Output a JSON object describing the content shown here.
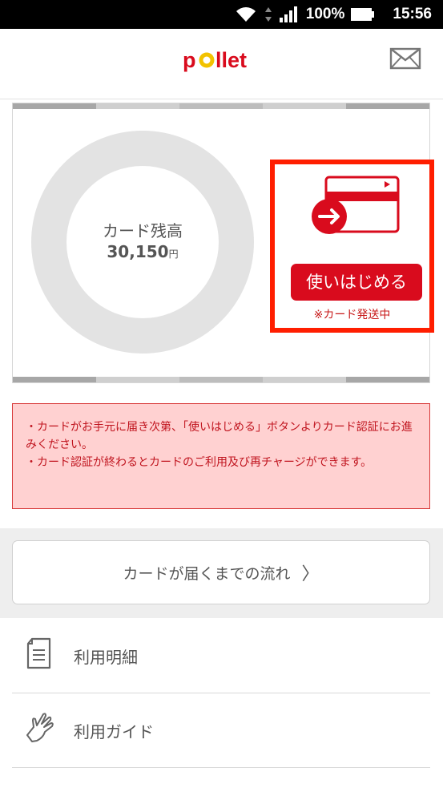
{
  "status_bar": {
    "battery": "100%",
    "time": "15:56"
  },
  "header": {
    "logo_text": "pollet"
  },
  "card_panel": {
    "balance_label": "カード残高",
    "balance_value": "30,150",
    "balance_unit": "円",
    "start_button_label": "使いはじめる",
    "shipping_note": "※カード発送中"
  },
  "notice": {
    "line1": "・カードがお手元に届き次第、「使いはじめる」ボタンよりカード認証にお進みください。",
    "line2": "・カード認証が終わるとカードのご利用及び再チャージができます。"
  },
  "flow_button": {
    "label": "カードが届くまでの流れ",
    "chevron": "〉"
  },
  "menu": {
    "items": [
      {
        "label": "利用明細",
        "icon": "document-icon"
      },
      {
        "label": "利用ガイド",
        "icon": "hand-icon"
      }
    ]
  },
  "colors": {
    "brand_red": "#d90b1d",
    "highlight_frame": "#ff1e00",
    "notice_bg": "#ffd1d1",
    "logo_yellow": "#f2c200"
  }
}
